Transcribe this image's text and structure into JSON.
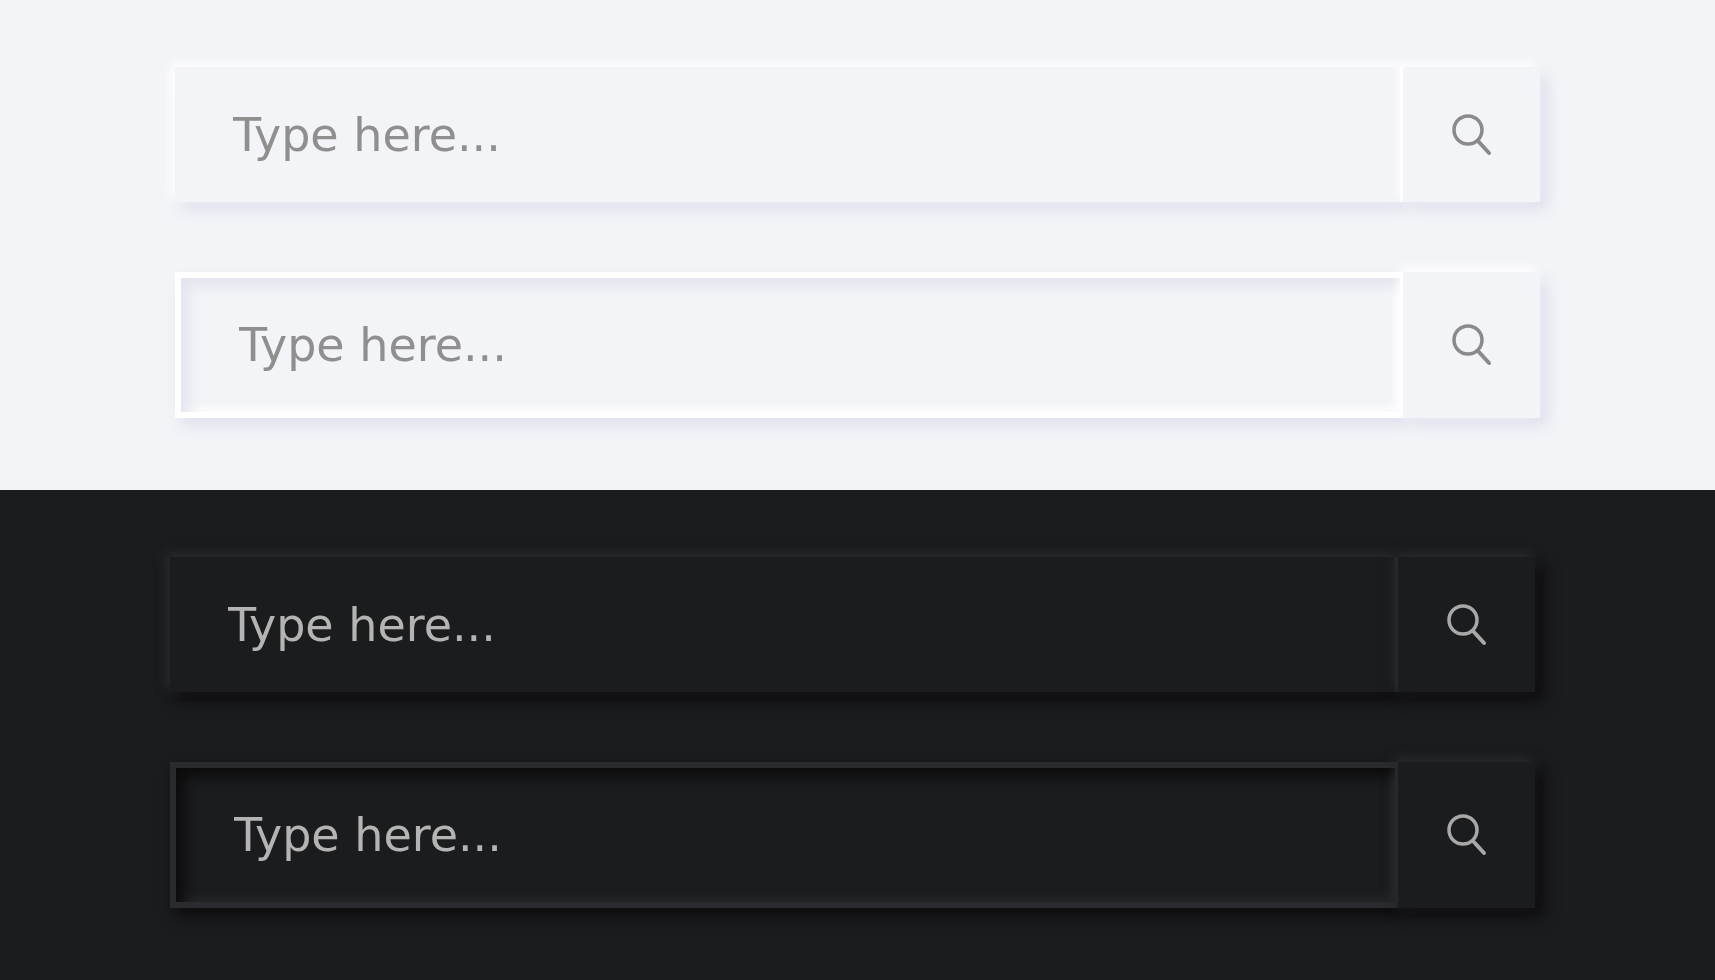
{
  "sections": [
    {
      "kind": "light",
      "bars": [
        {
          "kind": "raised",
          "placeholder": "Type here..."
        },
        {
          "kind": "inset",
          "placeholder": "Type here..."
        }
      ]
    },
    {
      "kind": "dark",
      "bars": [
        {
          "kind": "raised",
          "placeholder": "Type here..."
        },
        {
          "kind": "inset",
          "placeholder": "Type here..."
        }
      ]
    }
  ]
}
